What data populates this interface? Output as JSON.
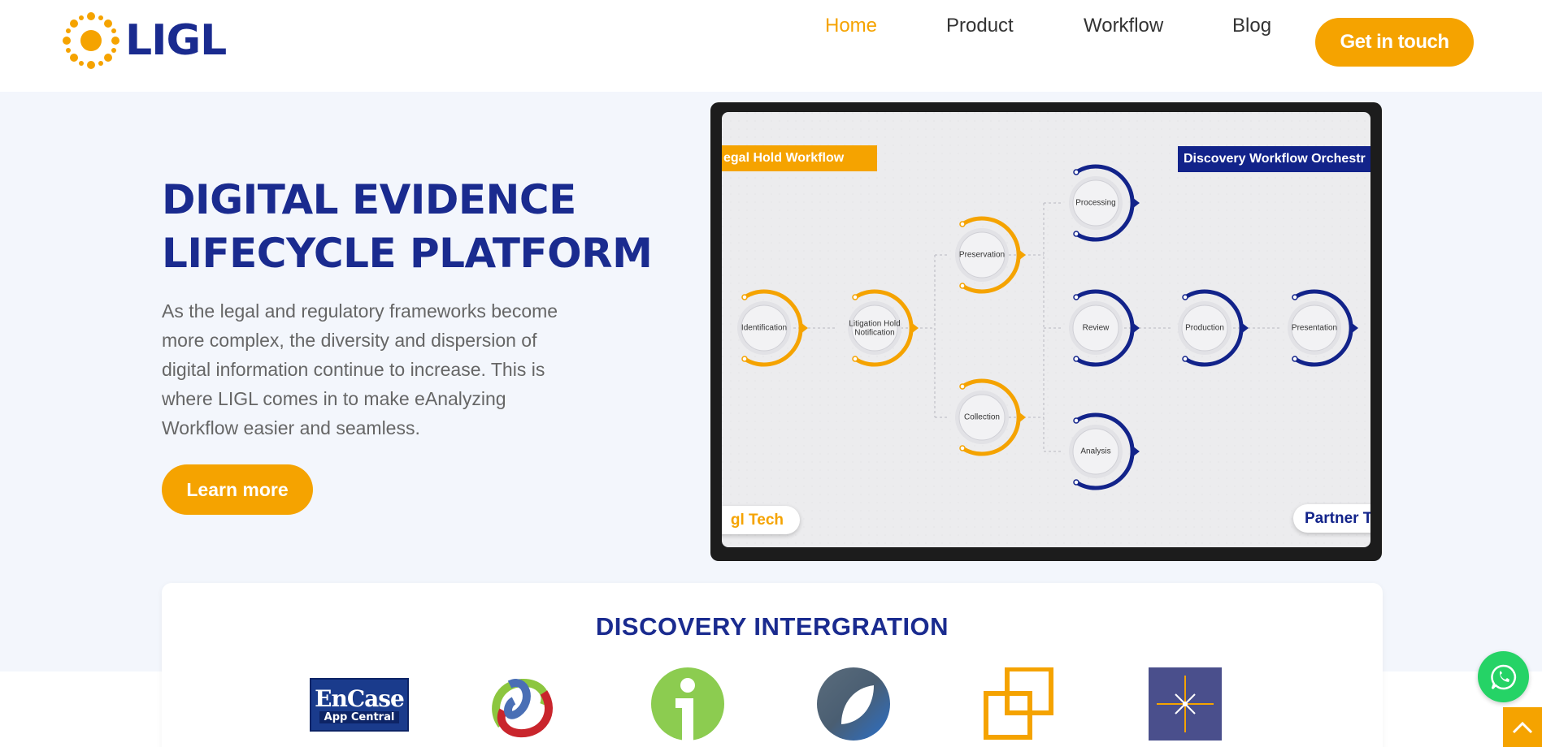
{
  "header": {
    "brand": "LIGL",
    "nav": [
      {
        "label": "Home",
        "active": true
      },
      {
        "label": "Product",
        "active": false
      },
      {
        "label": "Workflow",
        "active": false
      },
      {
        "label": "Blog",
        "active": false
      }
    ],
    "cta_label": "Get in touch"
  },
  "hero": {
    "title_line1": "DIGITAL EVIDENCE",
    "title_line2": "LIFECYCLE PLATFORM",
    "description": "As the legal and regulatory frameworks become more complex, the diversity and dispersion of digital information continue to increase. This is where LIGL comes in to make eAnalyzing Workflow easier and seamless.",
    "learn_more_label": "Learn more"
  },
  "workflow": {
    "left_tag": "egal Hold Workflow",
    "right_tag": "Discovery Workflow Orchestr",
    "left_pill": "gl Tech",
    "right_pill": "Partner T",
    "nodes": {
      "identification": "Identification",
      "litigation_1": "Litigation Hold",
      "litigation_2": "Notification",
      "preservation": "Preservation",
      "collection": "Collection",
      "processing": "Processing",
      "review": "Review",
      "analysis": "Analysis",
      "production": "Production",
      "presentation": "Presentation"
    }
  },
  "integration": {
    "title": "DISCOVERY INTERGRATION",
    "logos": [
      "encase-app-central",
      "swirl-logo",
      "info-i-logo",
      "leaf-circle-logo",
      "squares-logo",
      "star-node-logo"
    ],
    "encase_line1": "EnCase",
    "encase_line2": "App Central"
  },
  "colors": {
    "brand_blue": "#1a2b8f",
    "accent_orange": "#f5a300",
    "hero_bg": "#f3f6fc",
    "whatsapp_green": "#25d366"
  }
}
